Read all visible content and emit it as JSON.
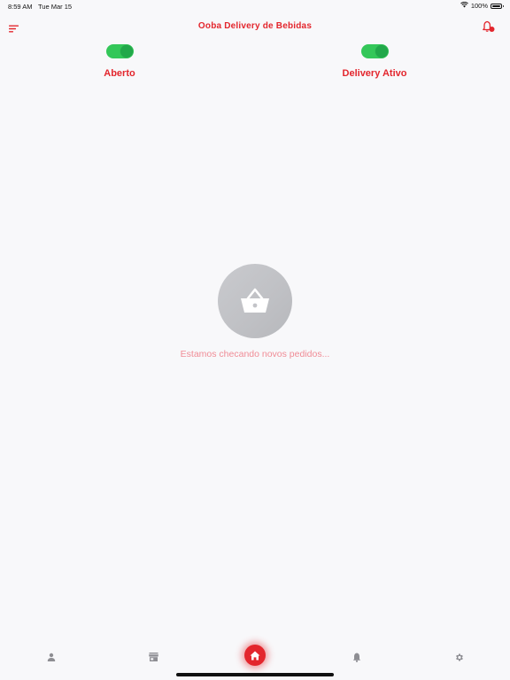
{
  "status_bar": {
    "time": "8:59 AM",
    "date": "Tue Mar 15",
    "battery": "100%"
  },
  "header": {
    "title": "Ooba Delivery de Bebidas",
    "menu_icon": "sort-menu-icon",
    "bell_icon": "bell-icon"
  },
  "toggles": {
    "open": {
      "label": "Aberto",
      "on": true
    },
    "delivery": {
      "label": "Delivery Ativo",
      "on": true
    }
  },
  "empty_state": {
    "icon": "shopping-basket-icon",
    "message": "Estamos checando novos pedidos..."
  },
  "bottom_nav": {
    "items": [
      {
        "icon": "person-icon",
        "active": false
      },
      {
        "icon": "store-icon",
        "active": false
      },
      {
        "icon": "home-icon",
        "active": true
      },
      {
        "icon": "bell-icon",
        "active": false
      },
      {
        "icon": "gear-icon",
        "active": false
      }
    ]
  },
  "colors": {
    "brand_red": "#e3262d",
    "toggle_green": "#34c759",
    "empty_text": "#f08c96",
    "nav_icon": "#8e8e93",
    "background": "#f8f8fa"
  }
}
